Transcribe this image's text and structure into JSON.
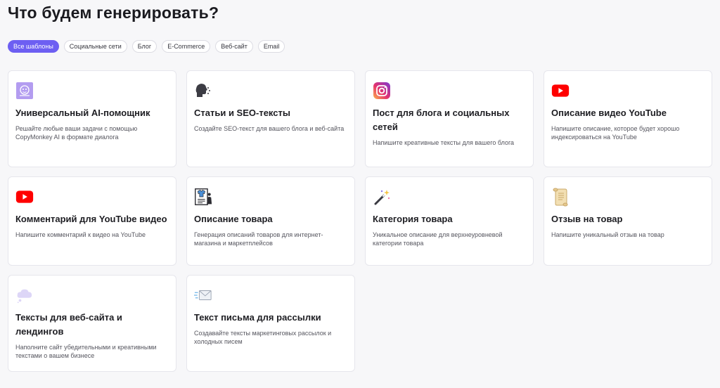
{
  "page": {
    "title": "Что будем генерировать?"
  },
  "filters": [
    {
      "label": "Все шаблоны",
      "active": true
    },
    {
      "label": "Социальные сети",
      "active": false
    },
    {
      "label": "Блог",
      "active": false
    },
    {
      "label": "E-Commerce",
      "active": false
    },
    {
      "label": "Веб-сайт",
      "active": false
    },
    {
      "label": "Email",
      "active": false
    }
  ],
  "cards": [
    {
      "icon": "ai-assistant-icon",
      "title": "Универсальный AI-помощник",
      "description": "Решайте любые ваши задачи с помощью CopyMonkey AI в формате диалога"
    },
    {
      "icon": "speaking-head-icon",
      "title": "Статьи и SEO-тексты",
      "description": "Создайте SEO-текст для вашего блога и веб-сайта"
    },
    {
      "icon": "instagram-icon",
      "title": "Пост для блога и социальных сетей",
      "description": "Напишите креативные тексты для вашего блога"
    },
    {
      "icon": "youtube-icon",
      "title": "Описание видео YouTube",
      "description": "Напишите описание, которое будет хорошо индексироваться на YouTube"
    },
    {
      "icon": "youtube-icon",
      "title": "Комментарий для YouTube видео",
      "description": "Напишите комментарий к видео на YouTube"
    },
    {
      "icon": "product-sheet-icon",
      "title": "Описание товара",
      "description": "Генерация описаний товаров для интернет-магазина и маркетплейсов"
    },
    {
      "icon": "magic-wand-icon",
      "title": "Категория товара",
      "description": "Уникальное описание для верхнеуровневой категории товара"
    },
    {
      "icon": "scroll-icon",
      "title": "Отзыв на товар",
      "description": "Напишите уникальный отзыв на товар"
    },
    {
      "icon": "thought-cloud-icon",
      "title": "Тексты для веб-сайта и лендингов",
      "description": "Наполните сайт убедительными и креативными текстами о вашем бизнесе"
    },
    {
      "icon": "envelope-icon",
      "title": "Текст письма для рассылки",
      "description": "Создавайте тексты маркетинговых рассылок и холодных писем"
    }
  ],
  "colors": {
    "accent": "#6d5ff2",
    "youtube": "#ff0000"
  }
}
